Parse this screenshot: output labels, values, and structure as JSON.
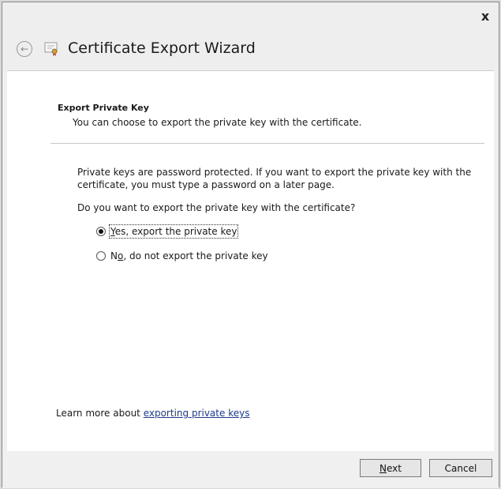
{
  "window": {
    "title": "Certificate Export Wizard",
    "close_label": "x",
    "back_icon": "back-arrow-icon",
    "wizard_icon": "certificate-icon"
  },
  "section": {
    "title": "Export Private Key",
    "subtitle": "You can choose to export the private key with the certificate."
  },
  "body": {
    "info": "Private keys are password protected. If you want to export the private key with the certificate, you must type a password on a later page.",
    "question": "Do you want to export the private key with the certificate?"
  },
  "options": [
    {
      "label_mnemonic": "Y",
      "label_rest": "es, export the private key",
      "checked": true
    },
    {
      "label_pre": "N",
      "label_mnemonic": "o",
      "label_rest": ", do not export the private key",
      "checked": false
    }
  ],
  "learn_more": {
    "prefix": "Learn more about ",
    "link": "exporting private keys"
  },
  "buttons": {
    "next_mnemonic": "N",
    "next_rest": "ext",
    "cancel": "Cancel"
  }
}
